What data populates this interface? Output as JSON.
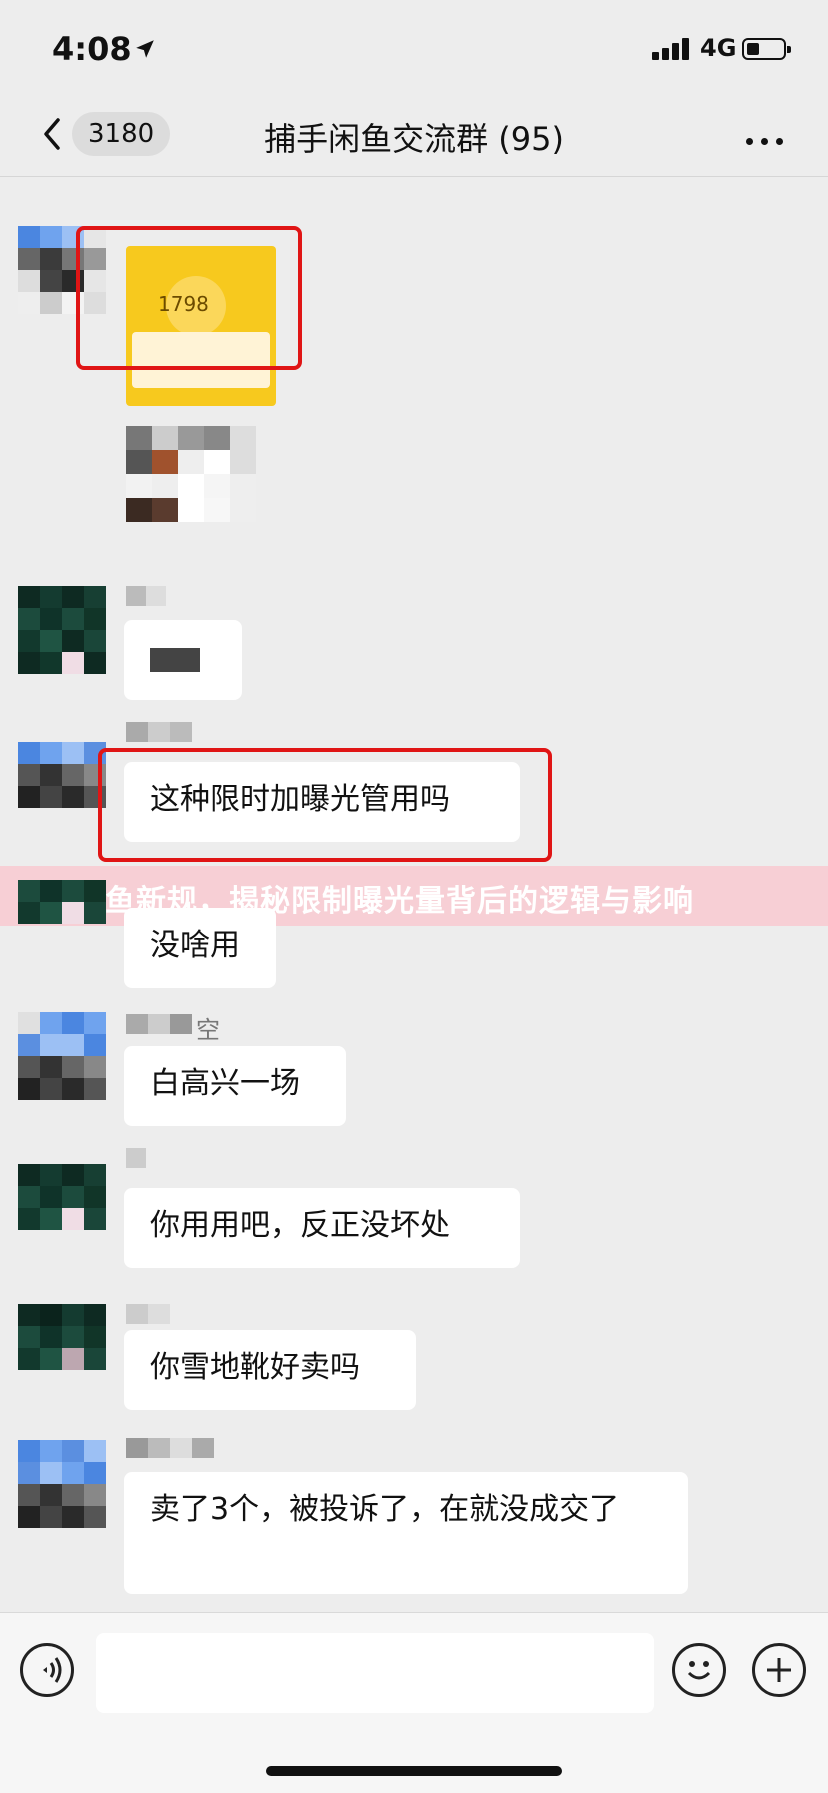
{
  "status_bar": {
    "time": "4:08",
    "network": "4G"
  },
  "header": {
    "unread_count": "3180",
    "title": "捕手闲鱼交流群 (95)"
  },
  "shared_image": {
    "number": "1798"
  },
  "messages": [
    {
      "text": ""
    },
    {
      "text": "这种限时加曝光管用吗"
    },
    {
      "text": "没啥用"
    },
    {
      "text": "白高兴一场"
    },
    {
      "text": "你用用吧，反正没坏处"
    },
    {
      "text": "你雪地靴好卖吗"
    },
    {
      "text": "卖了3个，被投诉了，在就没成交了"
    }
  ],
  "sender_fragments": {
    "m4": "空",
    "m5": ""
  },
  "banner": {
    "text": "咸鱼新规，揭秘限制曝光量背后的逻辑与影响"
  },
  "input": {
    "value": ""
  },
  "colors": {
    "background": "#ededed",
    "bubble": "#ffffff",
    "highlight": "#e01515",
    "banner": "#ffb6c1"
  }
}
